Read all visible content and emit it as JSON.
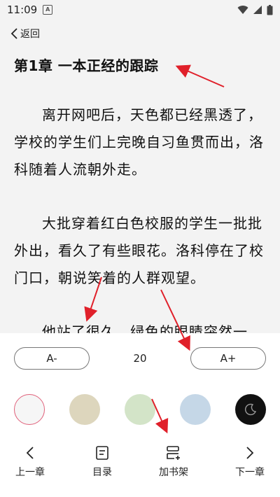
{
  "status_bar": {
    "time": "11:09",
    "notification_glyph": "A"
  },
  "top_bar": {
    "back_label": "返回"
  },
  "chapter": {
    "title": "第1章 一本正经的跟踪",
    "paragraphs": [
      "离开网吧后，天色都已经黑透了，学校的学生们上完晚自习鱼贯而出，洛科随着人流朝外走。",
      "大批穿着红白色校服的学生一批批外出，看久了有些眼花。洛科停在了校门口，朝说笑着的人群观望。",
      "他站了很久，绿色的眼睛突然一"
    ]
  },
  "font_controls": {
    "decrease_label": "A-",
    "size_value": "20",
    "increase_label": "A+"
  },
  "themes": [
    {
      "name": "white",
      "color": "#f6f6f6",
      "selected": true,
      "border": "#e0607a"
    },
    {
      "name": "beige",
      "color": "#ddd6bd"
    },
    {
      "name": "green",
      "color": "#d3e4c8"
    },
    {
      "name": "blue",
      "color": "#c5d7e7"
    },
    {
      "name": "night",
      "color": "#111111",
      "icon": "moon-icon"
    }
  ],
  "bottom_nav": {
    "prev_label": "上一章",
    "toc_label": "目录",
    "bookshelf_label": "加书架",
    "next_label": "下一章"
  },
  "colors": {
    "annotation_arrow": "#e0202a",
    "panel_bg": "#ffffff",
    "reader_bg": "#f3f3f3"
  }
}
